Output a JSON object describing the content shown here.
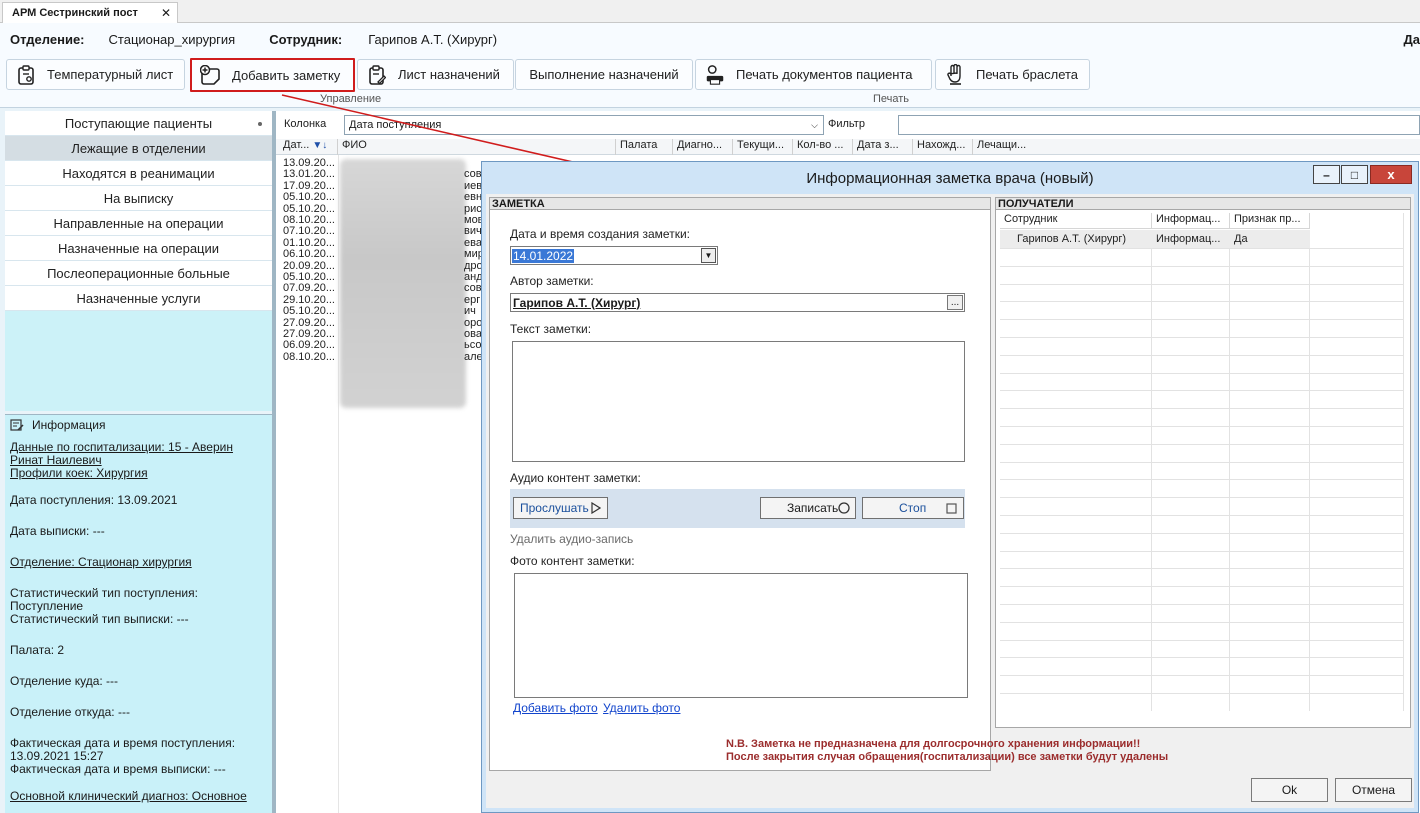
{
  "tab": {
    "title": "АРМ Сестринский пост",
    "close": "✕"
  },
  "header": {
    "dept_label": "Отделение:",
    "dept_value": "Стационар_хирургия",
    "emp_label": "Сотрудник:",
    "emp_value": "Гарипов А.Т. (Хирург)",
    "cut_label": "Да"
  },
  "ribbon": {
    "temp_sheet": "Температурный лист",
    "add_note": "Добавить заметку",
    "prescriptions": "Лист назначений",
    "execution": "Выполнение назначений",
    "print_docs": "Печать документов пациента",
    "print_bracelet": "Печать браслета",
    "group_manage": "Управление",
    "group_print": "Печать"
  },
  "nav": {
    "items": [
      "Поступающие пациенты",
      "Лежащие в отделении",
      "Находятся в реанимации",
      "На выписку",
      "Направленные на операции",
      "Назначенные на операции",
      "Послеоперационные больные",
      "Назначенные услуги"
    ]
  },
  "info": {
    "title": "Информация",
    "hosp_line1": "Данные по госпитализации: 15 - Аверин",
    "hosp_line2": "Ринат Наилевич",
    "beds": "Профили коек: Хирургия",
    "admit_date": "Дата поступления: 13.09.2021",
    "discharge_date": "Дата выписки: ---",
    "department": "Отделение: Стационар хирургия",
    "stat_in_1": "Статистический тип поступления:",
    "stat_in_2": "Поступление",
    "stat_out": "Статистический тип выписки: ---",
    "ward": "Палата: 2",
    "dept_to": "Отделение куда: ---",
    "dept_from": "Отделение откуда: ---",
    "actual_in_1": "Фактическая дата и время поступления:",
    "actual_in_2": "13.09.2021 15:27",
    "actual_out": "Фактическая дата и время выписки: ---",
    "diagnosis": "Основной клинический диагноз: Основное"
  },
  "grid": {
    "column_label": "Колонка",
    "column_value": "Дата поступления",
    "filter_label": "Фильтр",
    "headers": [
      "Дат...",
      "ФИО",
      "Палата",
      "Диагно...",
      "Текущи...",
      "Кол-во ...",
      "Дата з...",
      "Нахожд...",
      "Лечащи..."
    ],
    "dates": [
      "13.09.20...",
      "13.01.20...",
      "17.09.20...",
      "05.10.20...",
      "05.10.20...",
      "08.10.20...",
      "07.10.20...",
      "01.10.20...",
      "06.10.20...",
      "20.09.20...",
      "05.10.20...",
      "07.09.20...",
      "29.10.20...",
      "05.10.20...",
      "27.09.20...",
      "27.09.20...",
      "06.09.20...",
      "08.10.20..."
    ],
    "name_fragments": [
      "",
      "сов",
      "иев",
      "евн",
      "рис",
      "мов",
      "вич",
      "ева",
      "мир",
      "дро",
      "анд",
      "сов",
      "ерг",
      "ич",
      "оро",
      "ова",
      "ьсо",
      "але"
    ]
  },
  "modal": {
    "title": "Информационная заметка врача (новый)",
    "note_section": "ЗАМЕТКА",
    "date_label": "Дата и время создания заметки:",
    "date_value": "14.01.2022",
    "author_label": "Автор заметки:",
    "author_value": "Гарипов А.Т. (Хирург)",
    "author_btn": "...",
    "text_label": "Текст заметки:",
    "audio_label": "Аудио контент заметки:",
    "listen": "Прослушать",
    "record": "Записать",
    "stop": "Стоп",
    "delete_audio": "Удалить аудио-запись",
    "photo_label": "Фото контент заметки:",
    "add_photo": "Добавить фото",
    "delete_photo": "Удалить фото",
    "recipients_section": "ПОЛУЧАТЕЛИ",
    "recip_headers": [
      "Сотрудник",
      "Информац...",
      "Признак пр..."
    ],
    "recip_row": [
      "Гарипов А.Т. (Хирург)",
      "Информац...",
      "Да"
    ],
    "warning_1": "N.B. Заметка не предназначена для долгосрочного хранения информации!!",
    "warning_2": "После закрытия случая обращения(госпитализации) все заметки будут удалены",
    "ok": "Ok",
    "cancel": "Отмена",
    "min": "–",
    "max": "□",
    "close": "x"
  },
  "colors": {
    "highlight": "#d01c1c",
    "link": "#1144cc",
    "warning": "#9b2d2d",
    "nav_bg": "#ccf2f8"
  }
}
